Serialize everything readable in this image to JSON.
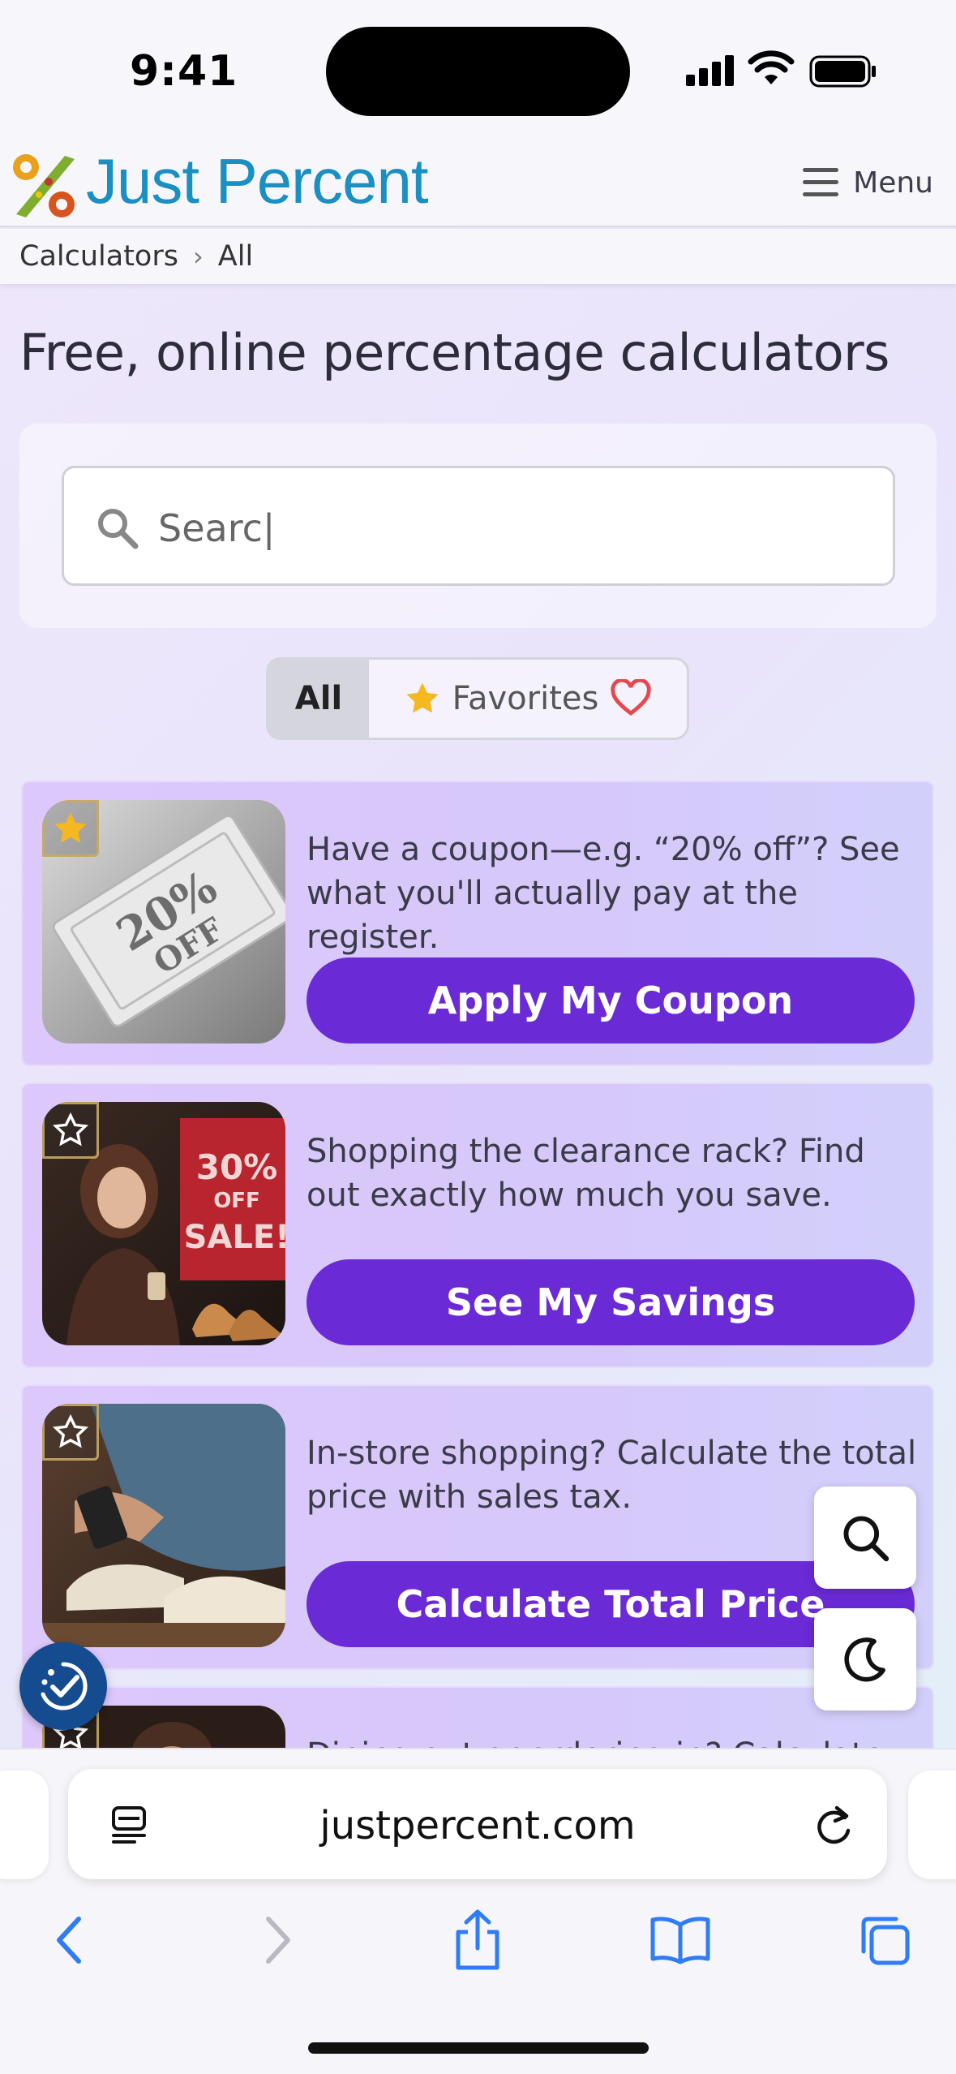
{
  "status_bar": {
    "time": "9:41"
  },
  "header": {
    "logo_name": "Just Percent",
    "menu_label": "Menu"
  },
  "breadcrumb": {
    "items": [
      "Calculators",
      "All"
    ],
    "separator": "›"
  },
  "page_title": "Free, online percentage calculators",
  "search": {
    "value": "Searc|",
    "placeholder": "Search"
  },
  "filters": {
    "all_label": "All",
    "favorites_label": "Favorites",
    "active": "All"
  },
  "cards": [
    {
      "description": "Have a coupon—e.g. “20% off”? See what you'll actually pay at the register.",
      "button": "Apply My Coupon",
      "favorited": true,
      "image_label": "20% OFF coupon"
    },
    {
      "description": "Shopping the clearance rack? Find out exactly how much you save.",
      "button": "See My Savings",
      "favorited": false,
      "image_label": "30% OFF SALE! shopper"
    },
    {
      "description": "In-store shopping? Calculate the total price with sales tax.",
      "button": "Calculate Total Price",
      "favorited": false,
      "image_label": "shoe shopper with phone"
    },
    {
      "description": "Dining out or ordering in? Calculate",
      "button": "",
      "favorited": false,
      "image_label": "restaurant"
    }
  ],
  "floating_buttons": {
    "search": "search-icon",
    "theme": "moon-icon",
    "accessibility": "accessibility-icon"
  },
  "browser": {
    "url": "justpercent.com"
  },
  "colors": {
    "brand_blue": "#1a8fc2",
    "button_purple": "#6a2bd6",
    "card_lilac": "#d8c9fb",
    "star_gold": "#f5b820",
    "heart_red": "#e5484d"
  }
}
